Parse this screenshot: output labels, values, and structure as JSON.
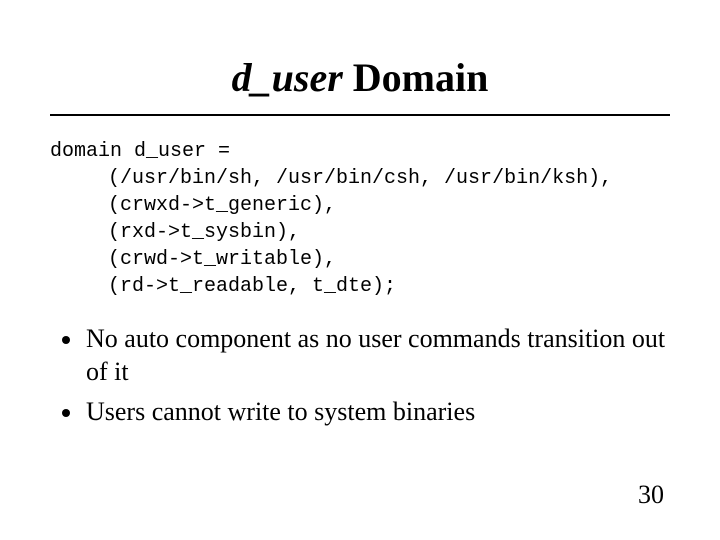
{
  "title": {
    "italic_part": "d_user",
    "rest": " Domain"
  },
  "code": {
    "line1": "domain d_user =",
    "line2": "(/usr/bin/sh, /usr/bin/csh, /usr/bin/ksh),",
    "line3": "(crwxd->t_generic),",
    "line4": "(rxd->t_sysbin),",
    "line5": "(crwd->t_writable),",
    "line6": "(rd->t_readable, t_dte);"
  },
  "bullets": [
    "No auto component as no user commands transition out of it",
    "Users cannot write to system binaries"
  ],
  "page_number": "30"
}
